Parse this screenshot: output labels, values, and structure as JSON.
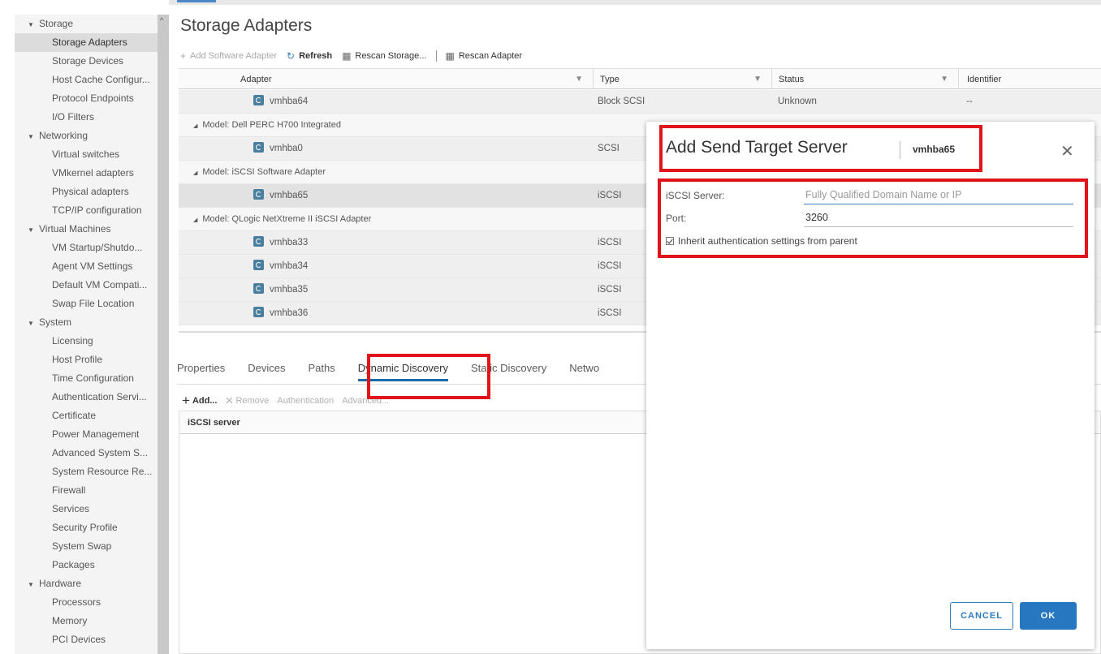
{
  "sidebar": {
    "rows": [
      {
        "kind": "section",
        "label": "Storage"
      },
      {
        "kind": "item",
        "label": "Storage Adapters",
        "selected": true
      },
      {
        "kind": "item",
        "label": "Storage Devices"
      },
      {
        "kind": "item",
        "label": "Host Cache Configur..."
      },
      {
        "kind": "item",
        "label": "Protocol Endpoints"
      },
      {
        "kind": "item",
        "label": "I/O Filters"
      },
      {
        "kind": "section",
        "label": "Networking"
      },
      {
        "kind": "item",
        "label": "Virtual switches"
      },
      {
        "kind": "item",
        "label": "VMkernel adapters"
      },
      {
        "kind": "item",
        "label": "Physical adapters"
      },
      {
        "kind": "item",
        "label": "TCP/IP configuration"
      },
      {
        "kind": "section",
        "label": "Virtual Machines"
      },
      {
        "kind": "item",
        "label": "VM Startup/Shutdo..."
      },
      {
        "kind": "item",
        "label": "Agent VM Settings"
      },
      {
        "kind": "item",
        "label": "Default VM Compati..."
      },
      {
        "kind": "item",
        "label": "Swap File Location"
      },
      {
        "kind": "section",
        "label": "System"
      },
      {
        "kind": "item",
        "label": "Licensing"
      },
      {
        "kind": "item",
        "label": "Host Profile"
      },
      {
        "kind": "item",
        "label": "Time Configuration"
      },
      {
        "kind": "item",
        "label": "Authentication Servi..."
      },
      {
        "kind": "item",
        "label": "Certificate"
      },
      {
        "kind": "item",
        "label": "Power Management"
      },
      {
        "kind": "item",
        "label": "Advanced System S..."
      },
      {
        "kind": "item",
        "label": "System Resource Re..."
      },
      {
        "kind": "item",
        "label": "Firewall"
      },
      {
        "kind": "item",
        "label": "Services"
      },
      {
        "kind": "item",
        "label": "Security Profile"
      },
      {
        "kind": "item",
        "label": "System Swap"
      },
      {
        "kind": "item",
        "label": "Packages"
      },
      {
        "kind": "section",
        "label": "Hardware"
      },
      {
        "kind": "item",
        "label": "Processors"
      },
      {
        "kind": "item",
        "label": "Memory"
      },
      {
        "kind": "item",
        "label": "PCI Devices"
      }
    ]
  },
  "page": {
    "title": "Storage Adapters"
  },
  "toolbar": {
    "add_software_adapter": "Add Software Adapter",
    "refresh": "Refresh",
    "rescan_storage": "Rescan Storage...",
    "rescan_adapter": "Rescan Adapter"
  },
  "adapter_table": {
    "columns": {
      "adapter": "Adapter",
      "type": "Type",
      "status": "Status",
      "identifier": "Identifier"
    },
    "rows": [
      {
        "kind": "data",
        "adapter": "vmhba64",
        "type": "Block SCSI",
        "status": "Unknown",
        "identifier": "--"
      },
      {
        "kind": "group",
        "label": "Model: Dell PERC H700 Integrated"
      },
      {
        "kind": "data",
        "adapter": "vmhba0",
        "type": "SCSI",
        "status": "",
        "identifier": ""
      },
      {
        "kind": "group",
        "label": "Model: iSCSI Software Adapter"
      },
      {
        "kind": "data",
        "adapter": "vmhba65",
        "type": "iSCSI",
        "status": "",
        "identifier": "",
        "selected": true
      },
      {
        "kind": "group",
        "label": "Model: QLogic NetXtreme II iSCSI Adapter"
      },
      {
        "kind": "data",
        "adapter": "vmhba33",
        "type": "iSCSI",
        "status": "",
        "identifier": ""
      },
      {
        "kind": "data",
        "adapter": "vmhba34",
        "type": "iSCSI",
        "status": "",
        "identifier": ""
      },
      {
        "kind": "data",
        "adapter": "vmhba35",
        "type": "iSCSI",
        "status": "",
        "identifier": ""
      },
      {
        "kind": "data",
        "adapter": "vmhba36",
        "type": "iSCSI",
        "status": "",
        "identifier": ""
      }
    ]
  },
  "tabs": [
    "Properties",
    "Devices",
    "Paths",
    "Dynamic Discovery",
    "Static Discovery",
    "Netwo"
  ],
  "active_tab": "Dynamic Discovery",
  "sub_toolbar": {
    "add": "Add...",
    "remove": "Remove",
    "authentication": "Authentication",
    "advanced": "Advanced..."
  },
  "discovery_table": {
    "header": "iSCSI server"
  },
  "dialog": {
    "title": "Add Send Target Server",
    "subtitle": "vmhba65",
    "iscsi_server_label": "iSCSI Server:",
    "iscsi_server_placeholder": "Fully Qualified Domain Name or IP",
    "iscsi_server_value": "",
    "port_label": "Port:",
    "port_value": "3260",
    "inherit_label": "Inherit authentication settings from parent",
    "inherit_checked": true,
    "cancel_label": "CANCEL",
    "ok_label": "OK"
  },
  "colors": {
    "accent": "#2677c0",
    "highlight": "#e0141b",
    "sidebar_bg": "#f4f4f4"
  }
}
